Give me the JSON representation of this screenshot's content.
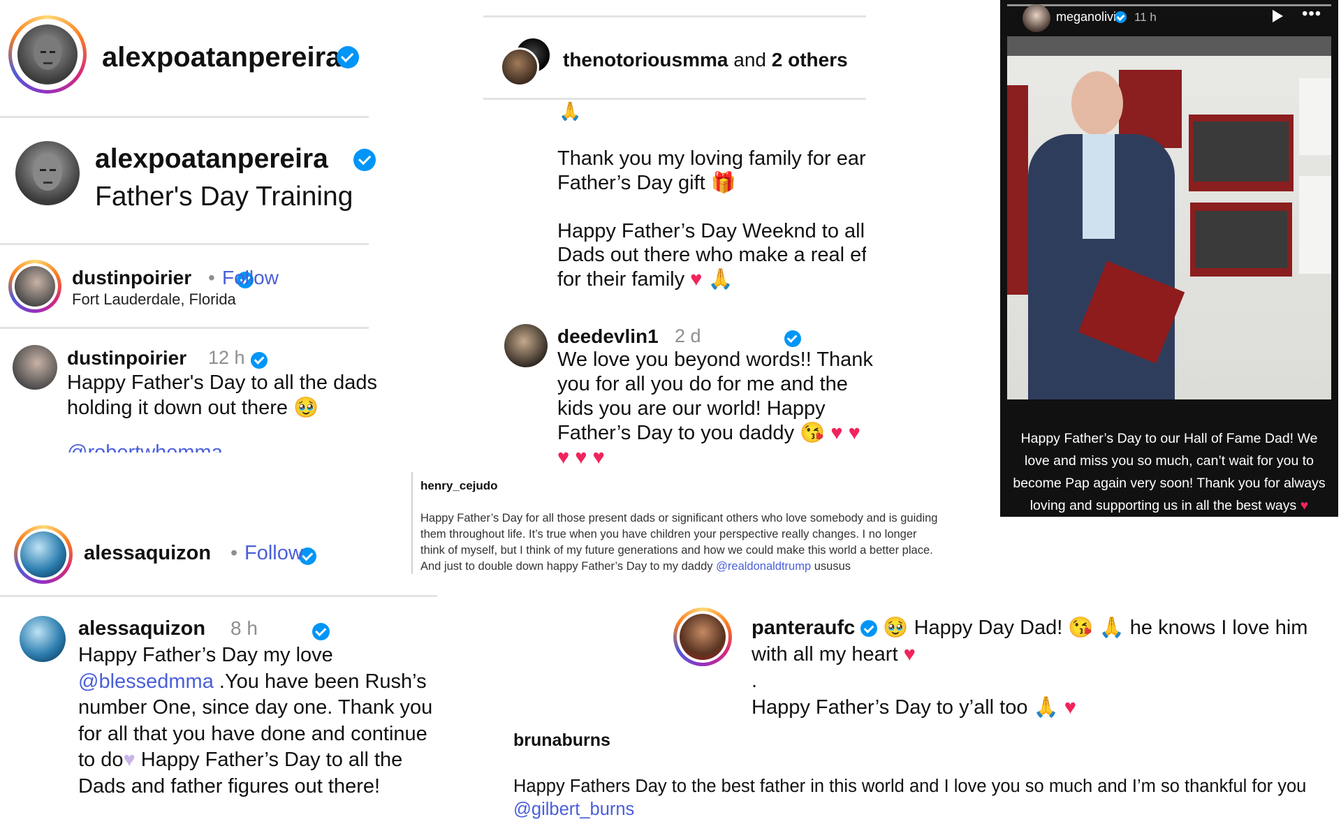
{
  "pereira_header": {
    "username": "alexpoatanpereira"
  },
  "pereira_post": {
    "username": "alexpoatanpereira",
    "title": "Father's Day Training"
  },
  "poirier_header": {
    "username": "dustinpoirier",
    "follow": "Follow",
    "location": "Fort Lauderdale, Florida"
  },
  "poirier_post": {
    "username": "dustinpoirier",
    "time": "12 h",
    "line1": "Happy Father's Day to all the dads",
    "line2": "holding it down out there",
    "partial_mention": "@robertwhemma"
  },
  "alessa_header": {
    "username": "alessaquizon",
    "follow": "Follow"
  },
  "alessa_post": {
    "username": "alessaquizon",
    "time": "8 h",
    "line1": "Happy Father’s Day my love",
    "mention": "@blessedmma",
    "line2": " .You have been Rush’s",
    "line3": "number One, since day one. Thank you",
    "line4": "for all that you have done and continue",
    "line5a": "to do",
    "line5b": " Happy Father’s Day to all the",
    "line6": "Dads and father figures out there!"
  },
  "mcgregor": {
    "username": "thenotoriousmma",
    "and": "and",
    "others": "2 others",
    "gift_line1": "Thank you my loving family for early",
    "gift_line2": "Father’s Day gift",
    "weeknd_line1": "Happy Father’s Day Weeknd to all the",
    "weeknd_line2": "Dads out there who make a real effor",
    "weeknd_line3": "for their family"
  },
  "devlin": {
    "username": "deedevlin1",
    "time": "2 d",
    "line1": "We love you beyond words!! Thank",
    "line2": "you for all you do for me and the",
    "line3": "kids you are our world! Happy",
    "line4": "Father’s Day to you daddy"
  },
  "cejudo": {
    "username": "henry_cejudo",
    "line1": "Happy Father’s Day for all those present dads or significant others who love somebody and is guiding",
    "line2": "them throughout life. It’s true when you have children your perspective really changes. I no longer",
    "line3": "think of myself, but I think of my future generations and how we could make this world a better place.",
    "line4": "And just to double down happy Father’s Day to my daddy",
    "mention": "@realdonaldtrump",
    "tail": " ususus"
  },
  "story": {
    "username": "meganolivi",
    "time": "11 h",
    "caption1": "Happy Father’s Day to our Hall of Fame Dad! We",
    "caption2": "love and miss you so much, can’t wait for you to",
    "caption3": "become Pap again very soon! Thank you for always",
    "caption4": "loving and supporting us in all the best ways"
  },
  "pantera": {
    "username": "panteraufc",
    "line1": "Happy Day Dad!",
    "line1b": "he knows I love him",
    "line2": "with all my heart",
    "dot": ".",
    "line3": "Happy Father’s Day to y’all too"
  },
  "bruna": {
    "username": "brunaburns",
    "line1": "Happy Fathers Day to the best father in this world and I love you so much and I’m so thankful for you",
    "mention": "@gilbert_burns"
  },
  "icons": [
    "verified-badge-icon",
    "play-icon",
    "more-icon",
    "heart-emoji",
    "prayer-hands-emoji",
    "gift-emoji",
    "kiss-emoji",
    "pleading-emoji"
  ],
  "colors": {
    "link": "#4a5fd9",
    "verified": "#0095f6",
    "heart": "#f0245c",
    "story_bg": "#111111"
  }
}
